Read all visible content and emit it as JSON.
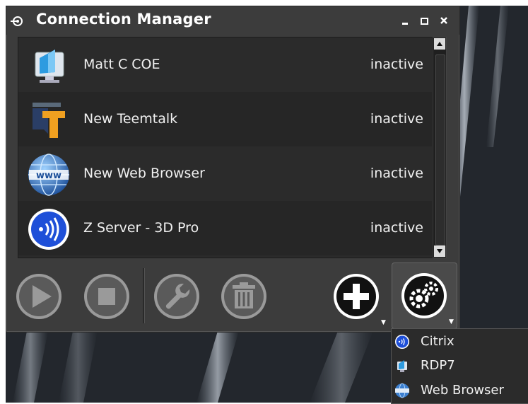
{
  "window": {
    "title": "Connection Manager",
    "controls": [
      "minimize",
      "maximize",
      "close"
    ]
  },
  "connections": [
    {
      "name": "Matt C COE",
      "status": "inactive",
      "icon": "rdp-monitor-icon"
    },
    {
      "name": "New Teemtalk",
      "status": "inactive",
      "icon": "teemtalk-icon"
    },
    {
      "name": "New Web Browser",
      "status": "inactive",
      "icon": "www-globe-icon"
    },
    {
      "name": "Z Server - 3D Pro",
      "status": "inactive",
      "icon": "citrix-icon"
    }
  ],
  "toolbar": {
    "buttons": [
      "connect-play",
      "disconnect-stop",
      "edit-wrench",
      "delete-trash",
      "add-plus",
      "settings-gears"
    ]
  },
  "add_menu": {
    "items": [
      {
        "label": "Citrix",
        "icon": "citrix-icon"
      },
      {
        "label": "RDP7",
        "icon": "rdp-monitor-icon"
      },
      {
        "label": "Web Browser",
        "icon": "www-globe-icon"
      }
    ]
  },
  "colors": {
    "window_bg": "#3c3c3c",
    "list_bg": "#2b2b2b",
    "text": "#f0f0f0",
    "citrix_blue": "#1e4fd8",
    "teemtalk_orange": "#f0a020"
  }
}
